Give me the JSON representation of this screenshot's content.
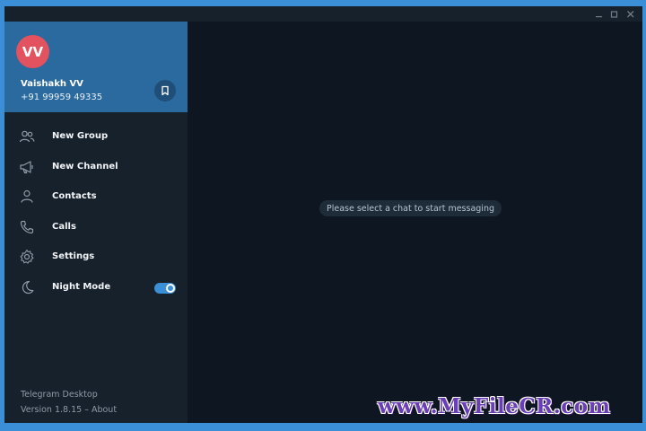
{
  "colors": {
    "accent": "#3a8fd6",
    "sidebar_bg": "#17212b",
    "profile_bg": "#2b6a9e",
    "avatar_bg": "#e2525f",
    "main_bg": "#0e1621"
  },
  "window": {
    "controls": {
      "minimize_icon": "minimize-icon",
      "maximize_icon": "maximize-icon",
      "close_icon": "close-icon"
    }
  },
  "profile": {
    "avatar_initials": "VV",
    "name": "Vaishakh VV",
    "phone": "+91 99959 49335",
    "saved_icon": "bookmark-icon"
  },
  "menu": {
    "items": [
      {
        "label": "New Group",
        "icon": "group-icon"
      },
      {
        "label": "New Channel",
        "icon": "megaphone-icon"
      },
      {
        "label": "Contacts",
        "icon": "person-icon"
      },
      {
        "label": "Calls",
        "icon": "phone-icon"
      },
      {
        "label": "Settings",
        "icon": "gear-icon"
      },
      {
        "label": "Night Mode",
        "icon": "moon-icon",
        "toggle_on": true
      }
    ]
  },
  "footer": {
    "app_name": "Telegram Desktop",
    "version": "Version 1.8.15 – About"
  },
  "main": {
    "empty_message": "Please select a chat to start messaging"
  },
  "watermark": {
    "text": "www.MyFileCR.com"
  }
}
